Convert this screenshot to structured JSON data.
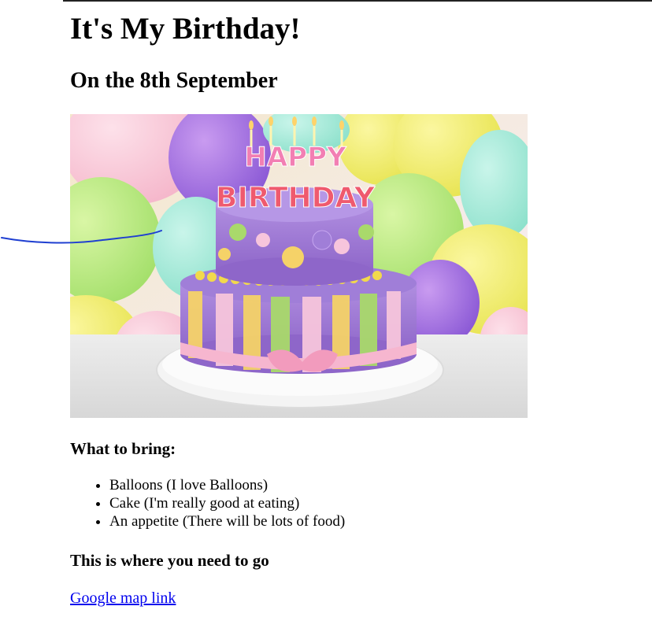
{
  "page": {
    "title": "It's My Birthday!",
    "subtitle": "On the 8th September"
  },
  "image": {
    "cake_text_top": "HAPPY",
    "cake_text_bottom": "BIRTHDAY"
  },
  "bring": {
    "heading": "What to bring:",
    "items": [
      "Balloons (I love Balloons)",
      "Cake (I'm really good at eating)",
      "An appetite (There will be lots of food)"
    ]
  },
  "directions": {
    "heading": "This is where you need to go",
    "link_label": "Google map link"
  },
  "colors": {
    "link": "#0000ee",
    "annotation_stroke": "#1f3fd1"
  }
}
